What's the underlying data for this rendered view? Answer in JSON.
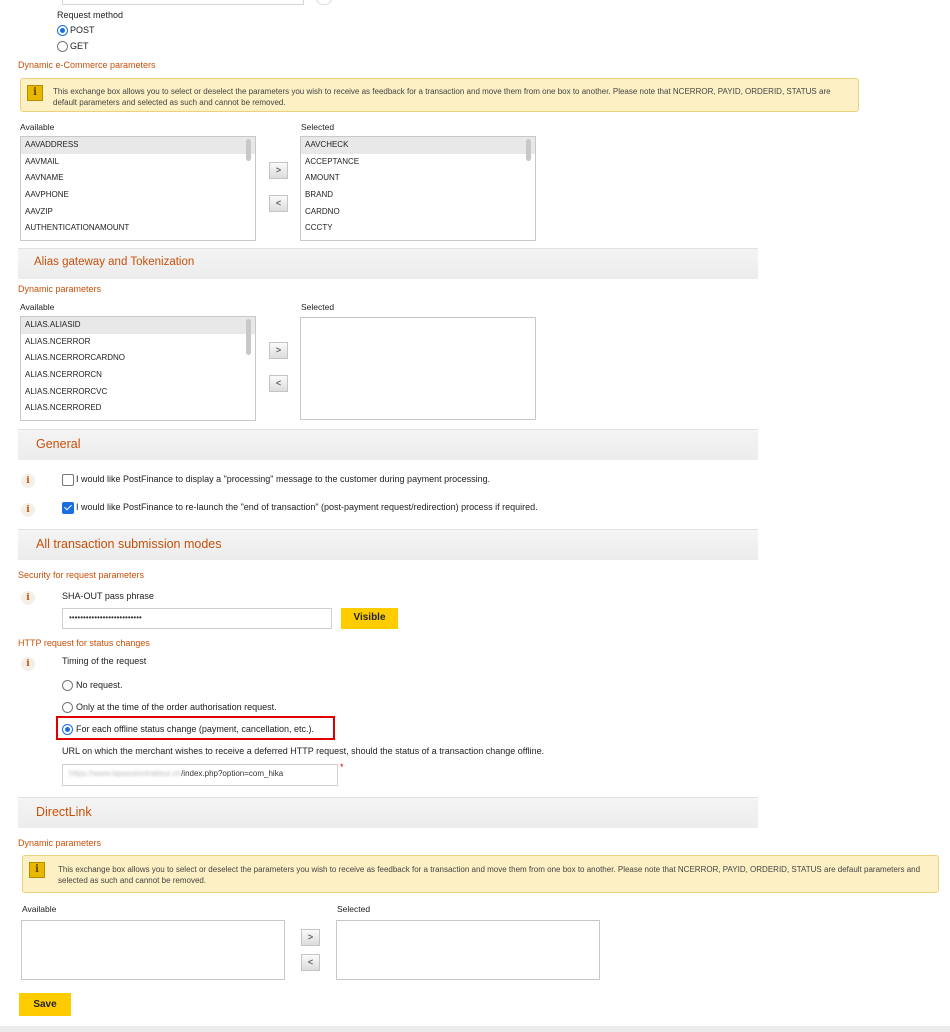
{
  "request_method": {
    "label": "Request method",
    "options": [
      {
        "label": "POST",
        "selected": true
      },
      {
        "label": "GET",
        "selected": false
      }
    ]
  },
  "ecommerce": {
    "heading": "Dynamic e-Commerce parameters",
    "notice": "This exchange box allows you to select or deselect the parameters you wish to receive as feedback for a transaction and move them from one box to another. Please note that NCERROR, PAYID, ORDERID, STATUS are default parameters and selected as such and cannot be removed.",
    "available_label": "Available",
    "selected_label": "Selected",
    "available": [
      "AAVADDRESS",
      "AAVMAIL",
      "AAVNAME",
      "AAVPHONE",
      "AAVZIP",
      "AUTHENTICATIONAMOUNT"
    ],
    "selected": [
      "AAVCHECK",
      "ACCEPTANCE",
      "AMOUNT",
      "BRAND",
      "CARDNO",
      "CCCTY"
    ]
  },
  "alias": {
    "section_title": "Alias gateway and Tokenization",
    "heading": "Dynamic parameters",
    "available_label": "Available",
    "selected_label": "Selected",
    "available": [
      "ALIAS.ALIASID",
      "ALIAS.NCERROR",
      "ALIAS.NCERRORCARDNO",
      "ALIAS.NCERRORCN",
      "ALIAS.NCERRORCVC",
      "ALIAS.NCERRORED"
    ]
  },
  "general": {
    "section_title": "General",
    "processing_label": "I would like PostFinance to display a \"processing\" message to the customer during payment processing.",
    "processing_checked": false,
    "relaunch_label": "I would like PostFinance to re-launch the \"end of transaction\" (post-payment request/redirection) process if required.",
    "relaunch_checked": true
  },
  "submission": {
    "section_title": "All transaction submission modes",
    "security_heading": "Security for request parameters",
    "sha_label": "SHA-OUT pass phrase",
    "sha_value": "••••••••••••••••••••••••••",
    "visible_button": "Visible",
    "http_heading": "HTTP request for status changes",
    "timing_label": "Timing of the request",
    "timing_options": [
      {
        "label": "No request.",
        "selected": false
      },
      {
        "label": "Only at the time of the order authorisation request.",
        "selected": false
      },
      {
        "label": "For each offline status change (payment, cancellation, etc.).",
        "selected": true
      }
    ],
    "url_label": "URL on which the merchant wishes to receive a deferred HTTP request, should the status of a transaction change offline.",
    "url_blurred": "https://www.lapassiontraiteur.ch",
    "url_value": "/index.php?option=com_hika",
    "required_mark": "*"
  },
  "directlink": {
    "section_title": "DirectLink",
    "heading": "Dynamic parameters",
    "notice": "This exchange box allows you to select or deselect the parameters you wish to receive as feedback for a transaction and move them from one box to another. Please note that NCERROR, PAYID, ORDERID, STATUS are default parameters and selected as such and cannot be removed.",
    "available_label": "Available",
    "selected_label": "Selected"
  },
  "save_button": "Save",
  "icons": {
    "warning": "warning-icon",
    "info": "info-icon",
    "move_right": "arrow-right-icon",
    "move_left": "arrow-left-icon"
  },
  "colors": {
    "accent": "#c8500a",
    "button_yellow": "#ffcc00",
    "notice_bg": "#fdf0c4",
    "highlight_box": "#e00000"
  }
}
